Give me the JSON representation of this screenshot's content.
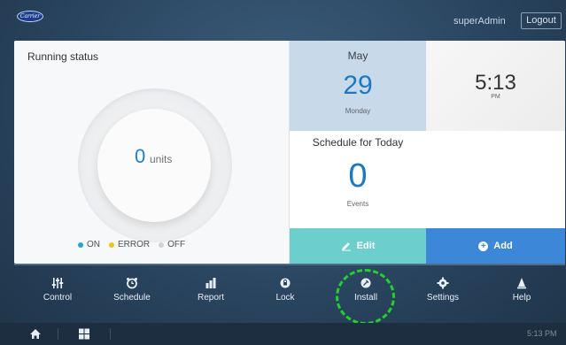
{
  "header": {
    "logo_text": "Carrier",
    "username": "superAdmin",
    "logout_label": "Logout"
  },
  "running_status": {
    "title": "Running status",
    "units_value": "0",
    "units_label": "units",
    "legend": [
      {
        "label": "ON",
        "color": "#1fa8d6"
      },
      {
        "label": "ERROR",
        "color": "#f2c318"
      },
      {
        "label": "OFF",
        "color": "#cfd3d6"
      }
    ]
  },
  "date": {
    "month": "May",
    "day": "29",
    "weekday": "Monday"
  },
  "time": {
    "value": "5:13",
    "ampm": "PM"
  },
  "schedule": {
    "title": "Schedule for Today",
    "count": "0",
    "count_label": "Events",
    "edit_label": "Edit",
    "add_label": "Add"
  },
  "nav": {
    "items": [
      {
        "label": "Control",
        "icon": "sliders-icon"
      },
      {
        "label": "Schedule",
        "icon": "alarm-clock-icon"
      },
      {
        "label": "Report",
        "icon": "bar-chart-icon"
      },
      {
        "label": "Lock",
        "icon": "lock-icon"
      },
      {
        "label": "Install",
        "icon": "install-icon"
      },
      {
        "label": "Settings",
        "icon": "gear-icon"
      },
      {
        "label": "Help",
        "icon": "help-icon"
      }
    ]
  },
  "taskbar": {
    "clock": "5:13 PM"
  },
  "colors": {
    "accent_blue": "#1d78c3",
    "edit_teal": "#6ccfce",
    "add_blue": "#3d87d8",
    "highlight_green": "#22d12a"
  }
}
